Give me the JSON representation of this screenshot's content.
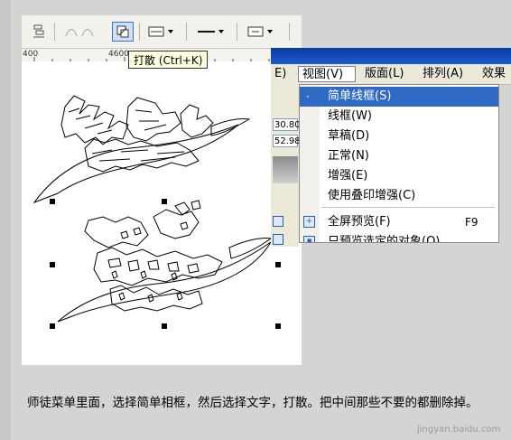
{
  "toolbar": {
    "buttons": [
      {
        "name": "align-icon"
      },
      {
        "name": "break-apart-grey-icon"
      },
      {
        "name": "break-apart-icon",
        "active": true
      },
      {
        "name": "outline-width-dropdown"
      },
      {
        "name": "line-style-dropdown"
      },
      {
        "name": "arrow-style-dropdown"
      }
    ]
  },
  "tooltip": {
    "text": "打散 (Ctrl+K)"
  },
  "ruler": {
    "labels": [
      "400",
      "4600"
    ]
  },
  "app": {
    "menubar": {
      "items": [
        {
          "label": "E)"
        },
        {
          "label": "视图(V)",
          "open": true
        },
        {
          "label": "版面(L)"
        },
        {
          "label": "排列(A)"
        },
        {
          "label": "效果"
        }
      ]
    },
    "behind_values": [
      "30.80",
      "52.98"
    ]
  },
  "view_menu": {
    "items": [
      {
        "label": "简单线框(S)",
        "selected": true,
        "bullet": "·"
      },
      {
        "label": "线框(W)"
      },
      {
        "label": "草稿(D)"
      },
      {
        "label": "正常(N)"
      },
      {
        "label": "增强(E)"
      },
      {
        "label": "使用叠印增强(C)"
      },
      {
        "label": "全屏预览(F)",
        "shortcut": "F9",
        "icon": "fullscreen-preview-icon"
      },
      {
        "label": "只预览选定的对象(O)",
        "icon": "preview-selected-icon"
      }
    ]
  },
  "caption": {
    "text": "师徒菜单里面，选择简单相框，然后选择文字，打散。把中间那些不要的都删除掉。"
  },
  "watermark": {
    "text": "jingyan.baidu.com"
  }
}
